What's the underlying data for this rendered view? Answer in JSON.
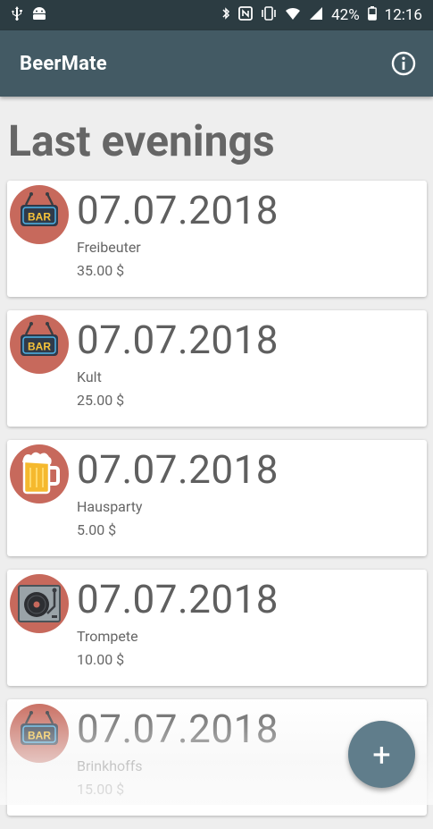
{
  "status_bar": {
    "battery": "42%",
    "time": "12:16",
    "left_icons": [
      "usb-icon",
      "android-icon"
    ],
    "right_icons": [
      "bluetooth-icon",
      "nfc-icon",
      "vibrate-icon",
      "wifi-icon",
      "signal-icon",
      "battery-icon"
    ]
  },
  "app_bar": {
    "title": "BeerMate",
    "info_icon": "info-icon"
  },
  "page": {
    "title": "Last evenings"
  },
  "evenings": [
    {
      "date": "07.07.2018",
      "place": "Freibeuter",
      "amount": "35.00 $",
      "icon": "bar-sign-icon"
    },
    {
      "date": "07.07.2018",
      "place": "Kult",
      "amount": "25.00 $",
      "icon": "bar-sign-icon"
    },
    {
      "date": "07.07.2018",
      "place": "Hausparty",
      "amount": "5.00 $",
      "icon": "beer-mug-icon"
    },
    {
      "date": "07.07.2018",
      "place": "Trompete",
      "amount": "10.00 $",
      "icon": "turntable-icon"
    },
    {
      "date": "07.07.2018",
      "place": "Brinkhoffs",
      "amount": "15.00 $",
      "icon": "bar-sign-icon"
    }
  ],
  "fab": {
    "label": "+"
  },
  "colors": {
    "status_bar": "#2c3c42",
    "app_bar": "#435a64",
    "avatar_bg": "#c7695c",
    "fab": "#607d8b",
    "background": "#eeeeee"
  }
}
